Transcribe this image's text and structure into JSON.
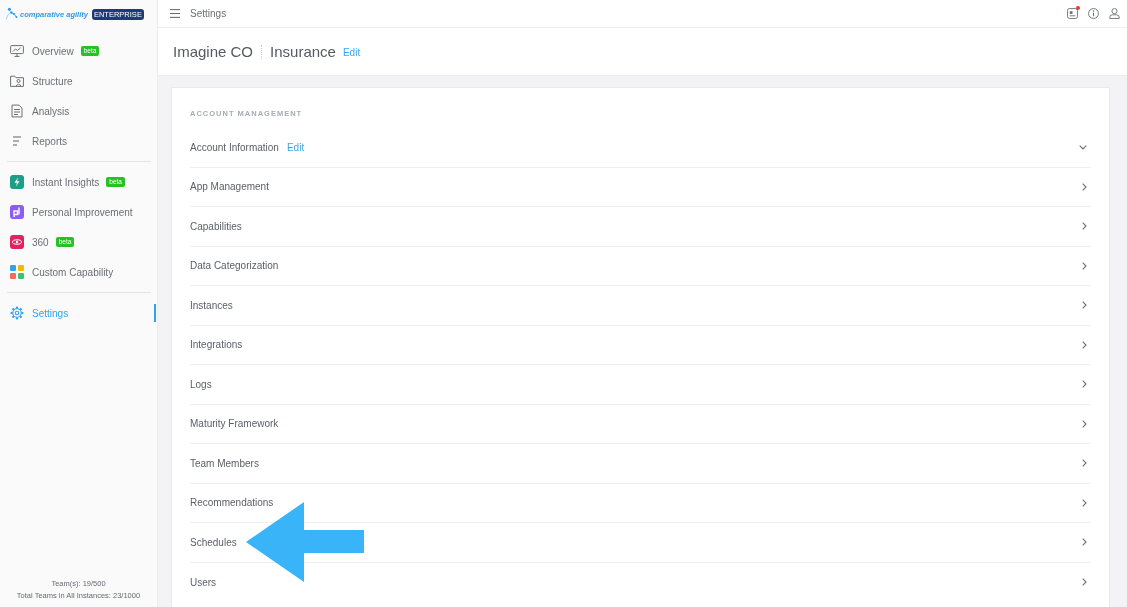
{
  "brand": {
    "name": "comparative agility",
    "edition": "ENTERPRISE"
  },
  "sidebar": {
    "groups": [
      {
        "items": [
          {
            "label": "Overview",
            "kind": "monitor",
            "badge": "beta",
            "selected": false
          },
          {
            "label": "Structure",
            "kind": "folder",
            "selected": false
          },
          {
            "label": "Analysis",
            "kind": "document",
            "selected": false
          },
          {
            "label": "Reports",
            "kind": "lines",
            "selected": false
          }
        ]
      },
      {
        "items": [
          {
            "label": "Instant Insights",
            "kind": "bolt-tile",
            "badge": "beta",
            "selected": false
          },
          {
            "label": "Personal Improvement",
            "kind": "p-tile",
            "selected": false
          },
          {
            "label": "360",
            "kind": "ring-tile",
            "badge": "beta",
            "selected": false
          },
          {
            "label": "Custom Capability",
            "kind": "squares",
            "selected": false
          }
        ]
      },
      {
        "items": [
          {
            "label": "Settings",
            "kind": "gear",
            "selected": true
          }
        ]
      }
    ],
    "footer": [
      "Team(s): 19/500",
      "Total Teams in All Instances: 23/1000"
    ]
  },
  "topbar": {
    "title": "Settings",
    "icons": [
      {
        "kind": "news",
        "dot": true
      },
      {
        "kind": "info",
        "dot": false
      },
      {
        "kind": "user",
        "dot": false
      }
    ]
  },
  "header": {
    "organization": "Imagine CO",
    "industry": "Insurance",
    "edit_link": "Edit"
  },
  "account_management": {
    "heading": "ACCOUNT MANAGEMENT",
    "rows": [
      {
        "label": "Account Information",
        "edit_link": "Edit",
        "expanded": true,
        "pointed_at": false
      },
      {
        "label": "App Management",
        "expanded": false,
        "pointed_at": false
      },
      {
        "label": "Capabilities",
        "expanded": false,
        "pointed_at": false
      },
      {
        "label": "Data Categorization",
        "expanded": false,
        "pointed_at": false
      },
      {
        "label": "Instances",
        "expanded": false,
        "pointed_at": false
      },
      {
        "label": "Integrations",
        "expanded": false,
        "pointed_at": false
      },
      {
        "label": "Logs",
        "expanded": false,
        "pointed_at": false
      },
      {
        "label": "Maturity Framework",
        "expanded": false,
        "pointed_at": false
      },
      {
        "label": "Team Members",
        "expanded": false,
        "pointed_at": false
      },
      {
        "label": "Recommendations",
        "expanded": false,
        "pointed_at": false
      },
      {
        "label": "Schedules",
        "expanded": false,
        "pointed_at": true
      },
      {
        "label": "Users",
        "expanded": false,
        "pointed_at": false
      }
    ]
  }
}
